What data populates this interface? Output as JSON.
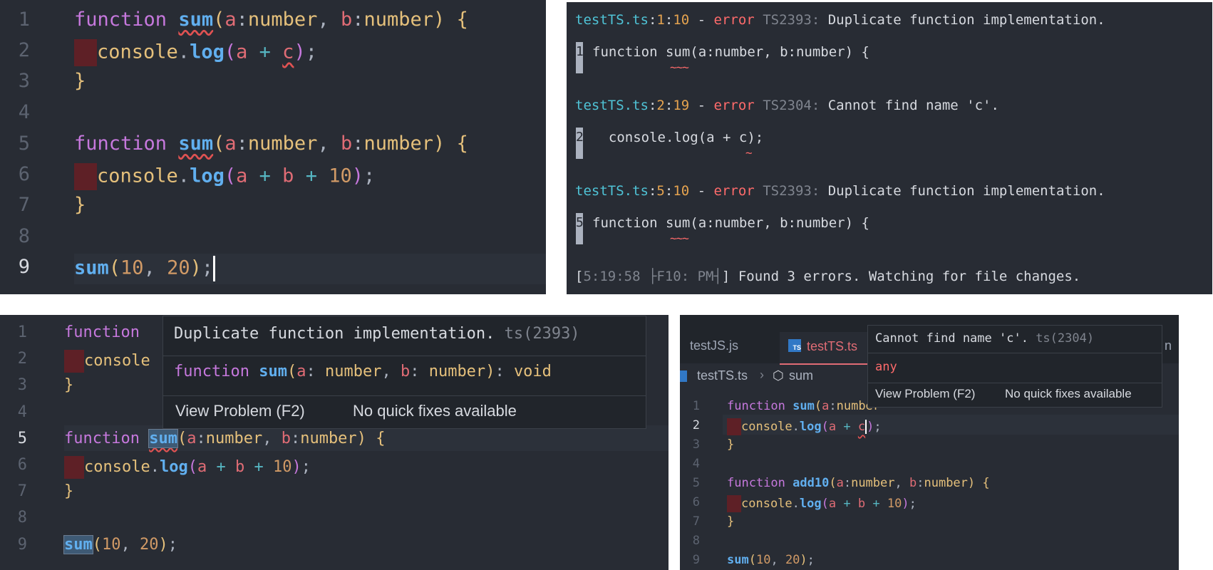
{
  "panel1": {
    "line_numbers": [
      "1",
      "2",
      "3",
      "4",
      "5",
      "6",
      "7",
      "8",
      "9"
    ],
    "l1": {
      "kw": "function",
      "fn": "sum",
      "p1": "a",
      "t1": "number",
      "p2": "b",
      "t2": "number"
    },
    "l2": {
      "obj": "console",
      "meth": "log",
      "a": "a",
      "c": "c"
    },
    "l6": {
      "obj": "console",
      "meth": "log",
      "a": "a",
      "b": "b",
      "n": "10"
    },
    "l9": {
      "fn": "sum",
      "n1": "10",
      "n2": "20"
    }
  },
  "panel2": {
    "e1": {
      "file": "testTS.ts",
      "line": "1",
      "col": "10",
      "label": "error",
      "code": "TS2393:",
      "msg": "Duplicate function implementation."
    },
    "e1_src": {
      "ln": "1",
      "code": "function sum(a:number, b:number) {"
    },
    "e2": {
      "file": "testTS.ts",
      "line": "2",
      "col": "19",
      "label": "error",
      "code": "TS2304:",
      "msg": "Cannot find name 'c'."
    },
    "e2_src": {
      "ln": "2",
      "code": "  console.log(a + c);"
    },
    "e3": {
      "file": "testTS.ts",
      "line": "5",
      "col": "10",
      "label": "error",
      "code": "TS2393:",
      "msg": "Duplicate function implementation."
    },
    "e3_src": {
      "ln": "5",
      "code": "function sum(a:number, b:number) {"
    },
    "status_time": "5:19:58 ├F10: PM┤",
    "status_msg": "Found 3 errors. Watching for file changes."
  },
  "panel3": {
    "line_numbers": [
      "1",
      "2",
      "3",
      "4",
      "5",
      "6",
      "7",
      "8",
      "9"
    ],
    "hover_msg": "Duplicate function implementation.",
    "hover_code": "ts(2393)",
    "hover_sig": {
      "kw": "function",
      "fn": "sum",
      "p1": "a",
      "t1": "number",
      "p2": "b",
      "t2": "number",
      "ret": "void"
    },
    "view_problem": "View Problem (F2)",
    "no_fixes": "No quick fixes available",
    "l1_kw": "function",
    "l2_obj": "console"
  },
  "panel4": {
    "tab1": "testJS.js",
    "tab2": "testTS.ts",
    "tab3_tail": "n",
    "breadcrumb_file": "testTS.ts",
    "breadcrumb_symbol": "sum",
    "line_numbers": [
      "1",
      "2",
      "3",
      "4",
      "5",
      "6",
      "7",
      "8",
      "9"
    ],
    "hover_msg": "Cannot find name 'c'.",
    "hover_code": "ts(2304)",
    "hover_type": "any",
    "view_problem": "View Problem (F2)",
    "no_fixes": "No quick fixes available",
    "l5_fn": "add10"
  }
}
